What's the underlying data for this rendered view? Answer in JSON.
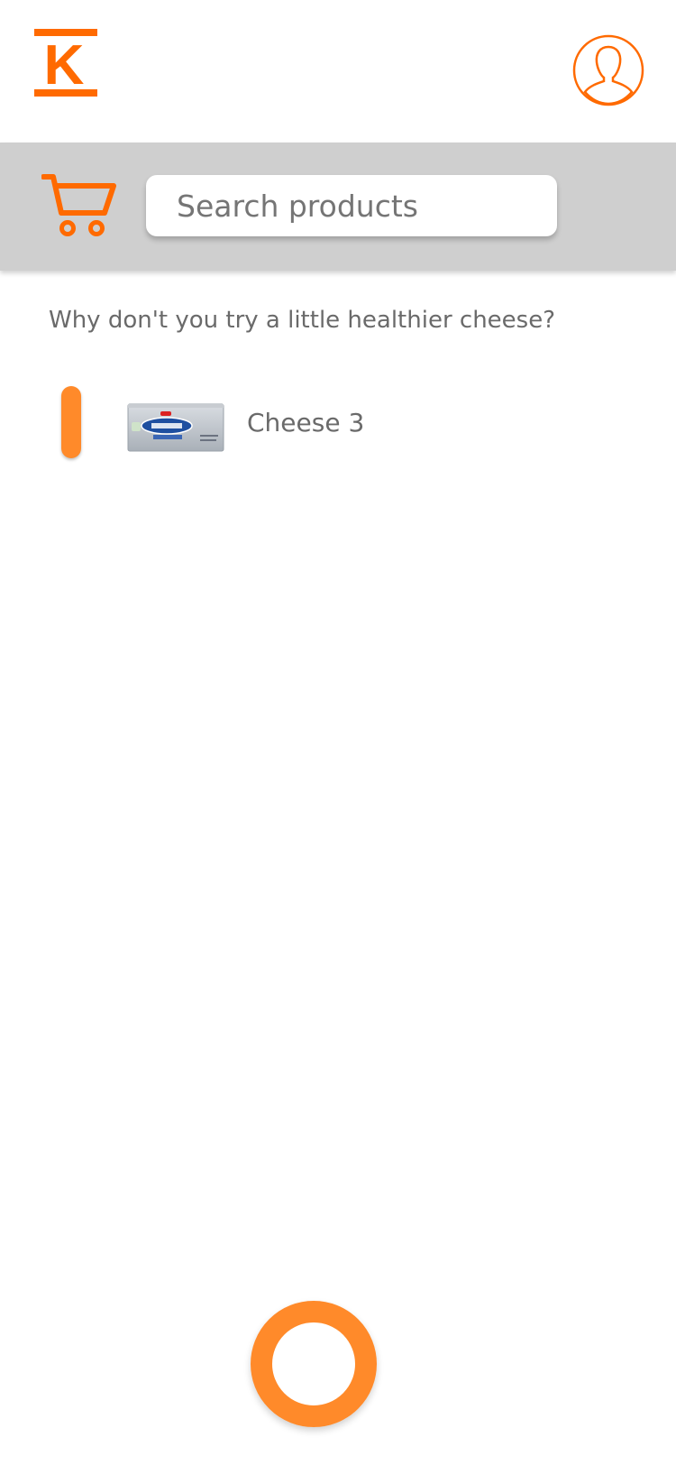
{
  "header": {
    "logo_icon": "k-logo-icon",
    "profile_icon": "user-profile-icon"
  },
  "search": {
    "cart_icon": "shopping-cart-icon",
    "placeholder": "Search products",
    "value": ""
  },
  "suggestion": {
    "text": "Why don't you try a little healthier cheese?"
  },
  "products": [
    {
      "name": "Cheese 3",
      "image_icon": "cream-cheese-package-image"
    }
  ],
  "colors": {
    "accent": "#ff6a00",
    "accent_light": "#ff8a2a",
    "band": "#cfcfcf",
    "text": "#6a6a6a"
  }
}
